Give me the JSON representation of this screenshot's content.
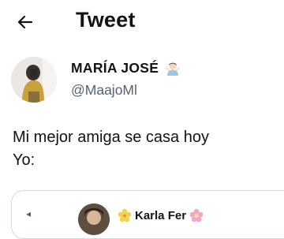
{
  "header": {
    "title": "Tweet",
    "back_icon": "arrow-left-icon"
  },
  "author": {
    "name": "MARÍA JOSÉ",
    "handle": "@MaajoMl",
    "emoji_icon": "person-gesturing-emoji-icon"
  },
  "tweet": {
    "lines": [
      "Mi mejor amiga se casa hoy",
      "Yo:"
    ]
  },
  "quote": {
    "name": "Karla Fer",
    "leading_flower_icon": "blossom-emoji-icon",
    "trailing_flower_icon": "cherry-blossom-emoji-icon"
  },
  "colors": {
    "text": "#0f1419",
    "secondary": "#536471",
    "border": "#cfd9de"
  }
}
